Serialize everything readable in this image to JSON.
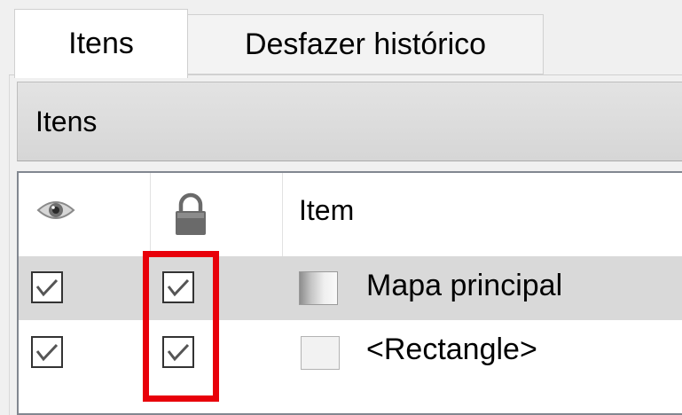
{
  "tabs": [
    {
      "label": "Itens",
      "active": true
    },
    {
      "label": "Desfazer histórico",
      "active": false
    }
  ],
  "panel": {
    "title": "Itens"
  },
  "columns": {
    "visibility_icon": "eye-icon",
    "lock_icon": "lock-icon",
    "item_header": "Item"
  },
  "items": [
    {
      "label": "Mapa principal",
      "visible": true,
      "locked": true,
      "icon": "map-item-icon"
    },
    {
      "label": "<Rectangle>",
      "visible": true,
      "locked": true,
      "icon": "rectangle-item-icon"
    }
  ],
  "colors": {
    "highlight": "#e8000a",
    "selected_row": "#d9d9d9"
  }
}
